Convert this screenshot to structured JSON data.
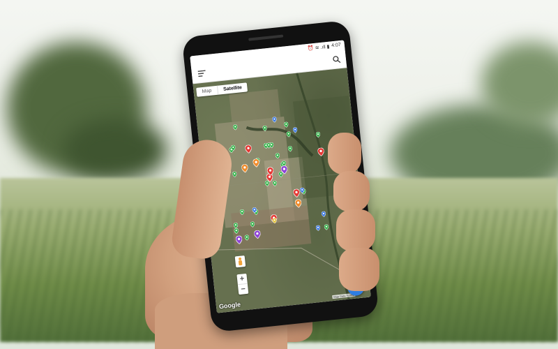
{
  "status_bar": {
    "time": "4:07",
    "indicators": "⏰ ≋ .ıll ▮"
  },
  "app_bar": {
    "menu_icon": "hamburger-menu-icon",
    "search_icon": "search-icon"
  },
  "map": {
    "type_toggle": {
      "map_label": "Map",
      "satellite_label": "Satellite",
      "selected": "Satellite"
    },
    "zoom_in_label": "+",
    "zoom_out_label": "−",
    "attribution": "Google",
    "map_data_label": "Map Data  Terms",
    "markers": {
      "green": 28,
      "red": 7,
      "blue": 6,
      "orange": 3,
      "purple": 4,
      "yellow": 1
    },
    "marker_colors": {
      "green": "#35b44a",
      "red": "#e53935",
      "blue": "#3f7be3",
      "orange": "#f08c2b",
      "purple": "#8e44d6",
      "yellow": "#e4c43a"
    }
  },
  "fab_location": {
    "icon": "location-pin-icon"
  },
  "fab_add": {
    "label": "+"
  },
  "colors": {
    "fab": "#2f7de1"
  }
}
